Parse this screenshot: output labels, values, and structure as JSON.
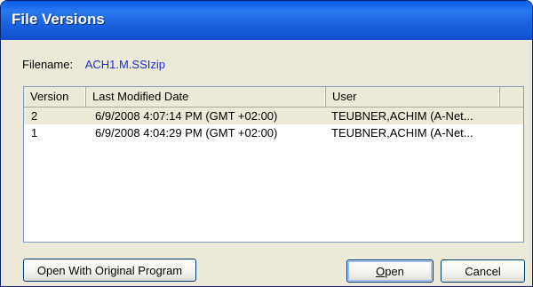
{
  "window": {
    "title": "File Versions"
  },
  "filename": {
    "label": "Filename:",
    "value": "ACH1.M.SSIzip"
  },
  "versions_list": {
    "columns": [
      "Version",
      "Last Modified Date",
      "User",
      ""
    ],
    "rows": [
      {
        "version": "2",
        "date": "6/9/2008 4:07:14 PM (GMT +02:00)",
        "user": "TEUBNER,ACHIM (A-Net...",
        "selected": true
      },
      {
        "version": "1",
        "date": "6/9/2008 4:04:29 PM (GMT +02:00)",
        "user": "TEUBNER,ACHIM (A-Net...",
        "selected": false
      }
    ]
  },
  "buttons": {
    "open_original": "Open With Original Program",
    "open_first": "O",
    "open_rest": "pen",
    "cancel": "Cancel"
  },
  "colors": {
    "titlebar": "#0a5ae8",
    "dialog_bg": "#ece9d8",
    "filename_value": "#1a2ed8"
  }
}
